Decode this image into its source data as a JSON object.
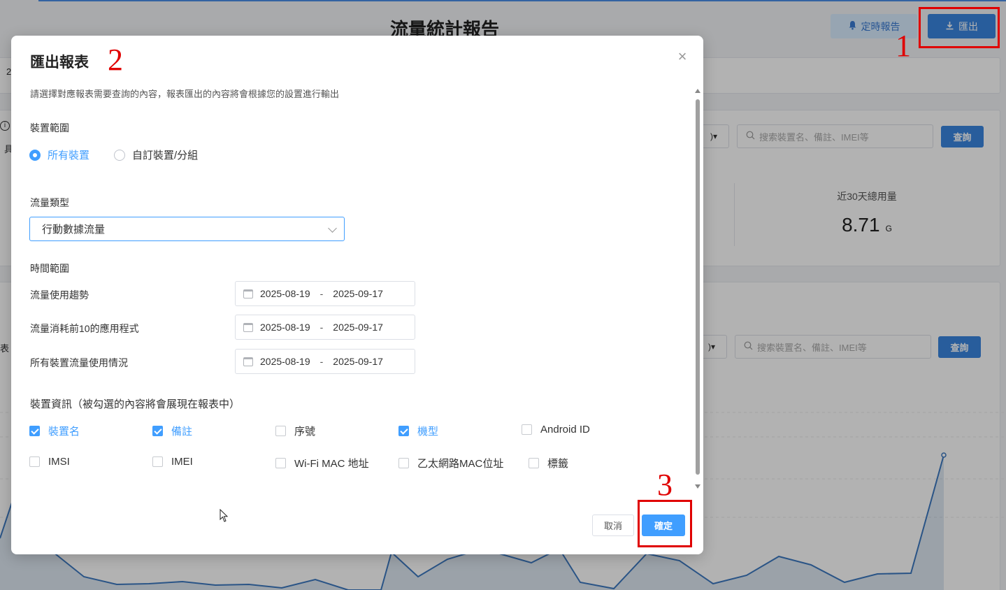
{
  "page": {
    "title": "流量統計報告",
    "schedule_button": "定時報告",
    "export_button": "匯出",
    "left_fragments": [
      "2",
      "i",
      "具",
      "表"
    ],
    "search_placeholder": "搜索裝置名、備註、IMEI等",
    "query_button": "查詢",
    "stat_label": "近30天總用量",
    "stat_value": "8.71",
    "stat_unit": "G",
    "caret": ")▾"
  },
  "annotations": {
    "marker_1": "1",
    "marker_2": "2",
    "marker_3": "3"
  },
  "modal": {
    "title": "匯出報表",
    "description": "請選擇對應報表需要查詢的內容，報表匯出的內容將會根據您的設置進行輸出",
    "device_scope": {
      "label": "裝置範圍",
      "options": [
        {
          "label": "所有裝置",
          "selected": true
        },
        {
          "label": "自訂裝置/分組",
          "selected": false
        }
      ]
    },
    "traffic_type": {
      "label": "流量類型",
      "value": "行動數據流量"
    },
    "time_range": {
      "label": "時間範圍",
      "rows": [
        {
          "label": "流量使用趨勢",
          "start": "2025-08-19",
          "end": "2025-09-17"
        },
        {
          "label": "流量消耗前10的應用程式",
          "start": "2025-08-19",
          "end": "2025-09-17"
        },
        {
          "label": "所有裝置流量使用情況",
          "start": "2025-08-19",
          "end": "2025-09-17"
        }
      ],
      "separator": "-"
    },
    "device_info": {
      "label": "裝置資訊（被勾選的內容將會展現在報表中）",
      "fields": [
        {
          "label": "裝置名",
          "checked": true
        },
        {
          "label": "備註",
          "checked": true
        },
        {
          "label": "序號",
          "checked": false
        },
        {
          "label": "機型",
          "checked": true
        },
        {
          "label": "Android ID",
          "checked": false
        },
        {
          "label": "IMSI",
          "checked": false
        },
        {
          "label": "IMEI",
          "checked": false
        },
        {
          "label": "Wi-Fi MAC 地址",
          "checked": false
        },
        {
          "label": "乙太網路MAC位址",
          "checked": false
        },
        {
          "label": "標籤",
          "checked": false
        }
      ]
    },
    "cancel_button": "取消",
    "confirm_button": "確定"
  },
  "colors": {
    "primary": "#409eff",
    "export_btn": "#3a86e0",
    "annotation_red": "#e00000"
  }
}
